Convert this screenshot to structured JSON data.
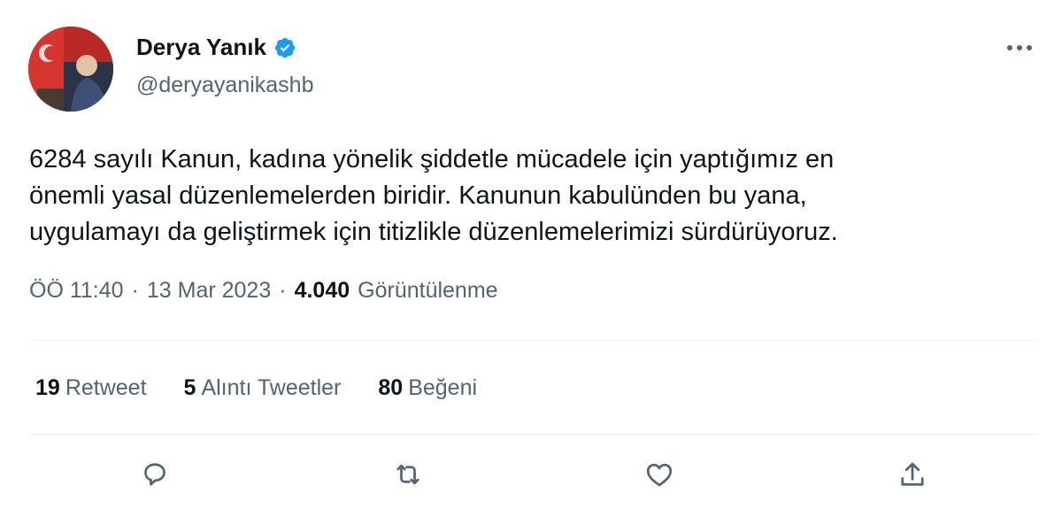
{
  "author": {
    "display_name": "Derya Yanık",
    "handle": "@deryayanikashb",
    "verified": true
  },
  "tweet": {
    "lines": [
      "6284 sayılı Kanun, kadına yönelik şiddetle mücadele için yaptığımız en",
      "önemli yasal düzenlemelerden biridir. Kanunun kabulünden bu yana,",
      "uygulamayı da geliştirmek için titizlikle düzenlemelerimizi sürdürüyoruz."
    ]
  },
  "meta": {
    "time": "ÖÖ 11:40",
    "separator": "·",
    "date": "13 Mar 2023",
    "views_count": "4.040",
    "views_label": "Görüntülenme"
  },
  "stats": {
    "retweets_count": "19",
    "retweets_label": "Retweet",
    "quotes_count": "5",
    "quotes_label": "Alıntı Tweetler",
    "likes_count": "80",
    "likes_label": "Beğeni"
  },
  "icons": {
    "verified": "verified-badge-icon",
    "more": "more-dots-icon",
    "reply": "reply-icon",
    "retweet": "retweet-icon",
    "like": "heart-icon",
    "share": "share-icon"
  },
  "colors": {
    "text": "#0f1419",
    "secondary": "#536471",
    "verified": "#1d9bf0",
    "divider": "#eff3f4"
  }
}
